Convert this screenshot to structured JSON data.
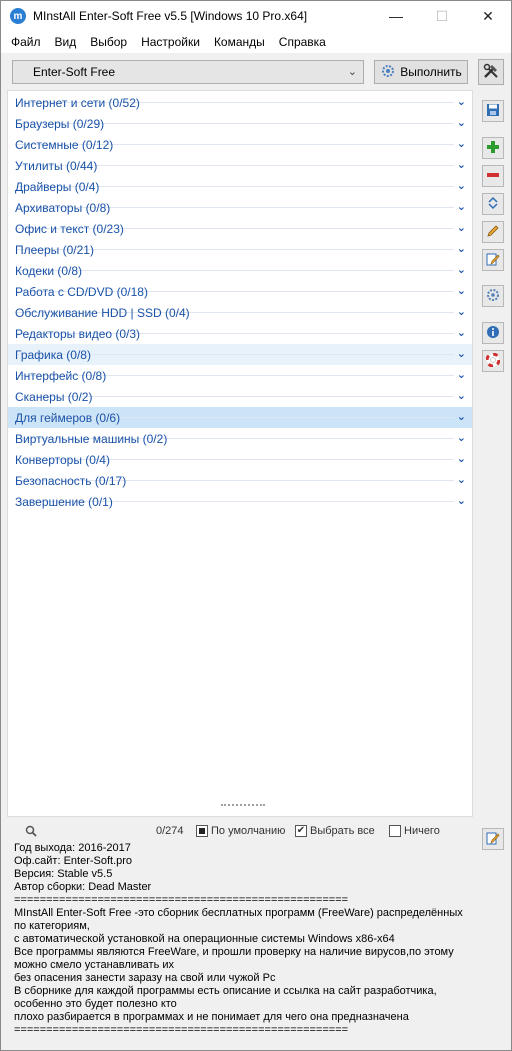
{
  "window": {
    "title": "MInstAll Enter-Soft Free v5.5 [Windows 10 Pro.x64]",
    "minimize": "—",
    "maximize": "☐",
    "close": "✕"
  },
  "menu": [
    "Файл",
    "Вид",
    "Выбор",
    "Настройки",
    "Команды",
    "Справка"
  ],
  "toolbar": {
    "profile_value": "Enter-Soft Free",
    "run_label": "Выполнить"
  },
  "categories": [
    "Интернет и сети  (0/52)",
    "Браузеры  (0/29)",
    "Системные  (0/12)",
    "Утилиты  (0/44)",
    "Драйверы  (0/4)",
    "Архиваторы  (0/8)",
    "Офис и текст  (0/23)",
    "Плееры  (0/21)",
    "Кодеки  (0/8)",
    "Работа с CD/DVD  (0/18)",
    "Обслуживание HDD | SSD  (0/4)",
    "Редакторы видео  (0/3)",
    "Графика  (0/8)",
    "Интерфейс  (0/8)",
    "Сканеры  (0/2)",
    "Для геймеров  (0/6)",
    "Виртуальные машины  (0/2)",
    "Конверторы  (0/4)",
    "Безопасность  (0/17)",
    "Завершение  (0/1)"
  ],
  "filter": {
    "count": "0/274",
    "default_label": "По умолчанию",
    "select_all_label": "Выбрать все",
    "none_label": "Ничего"
  },
  "info_text": "Год выхода: 2016-2017\nОф.сайт: Enter-Soft.pro\nВерсия: Stable v5.5\nАвтор сборки: Dead Master\n====================================================\nMInstAll Enter-Soft Free -это сборник бесплатных программ (FreeWare) распределённых по категориям,\nс автоматической установкой на операционные системы Windows x86-x64\nВсе программы являются FreeWare, и прошли проверку на наличие вирусов,по этому можно смело устанавливать их\nбез опасения занести заразу на свой или чужой Pc\nВ сборнике для каждой программы есть описание и ссылка на сайт разработчика, особенно это будет полезно кто\nплохо разбирается в программах и не понимает для чего она предназначена\n===================================================="
}
